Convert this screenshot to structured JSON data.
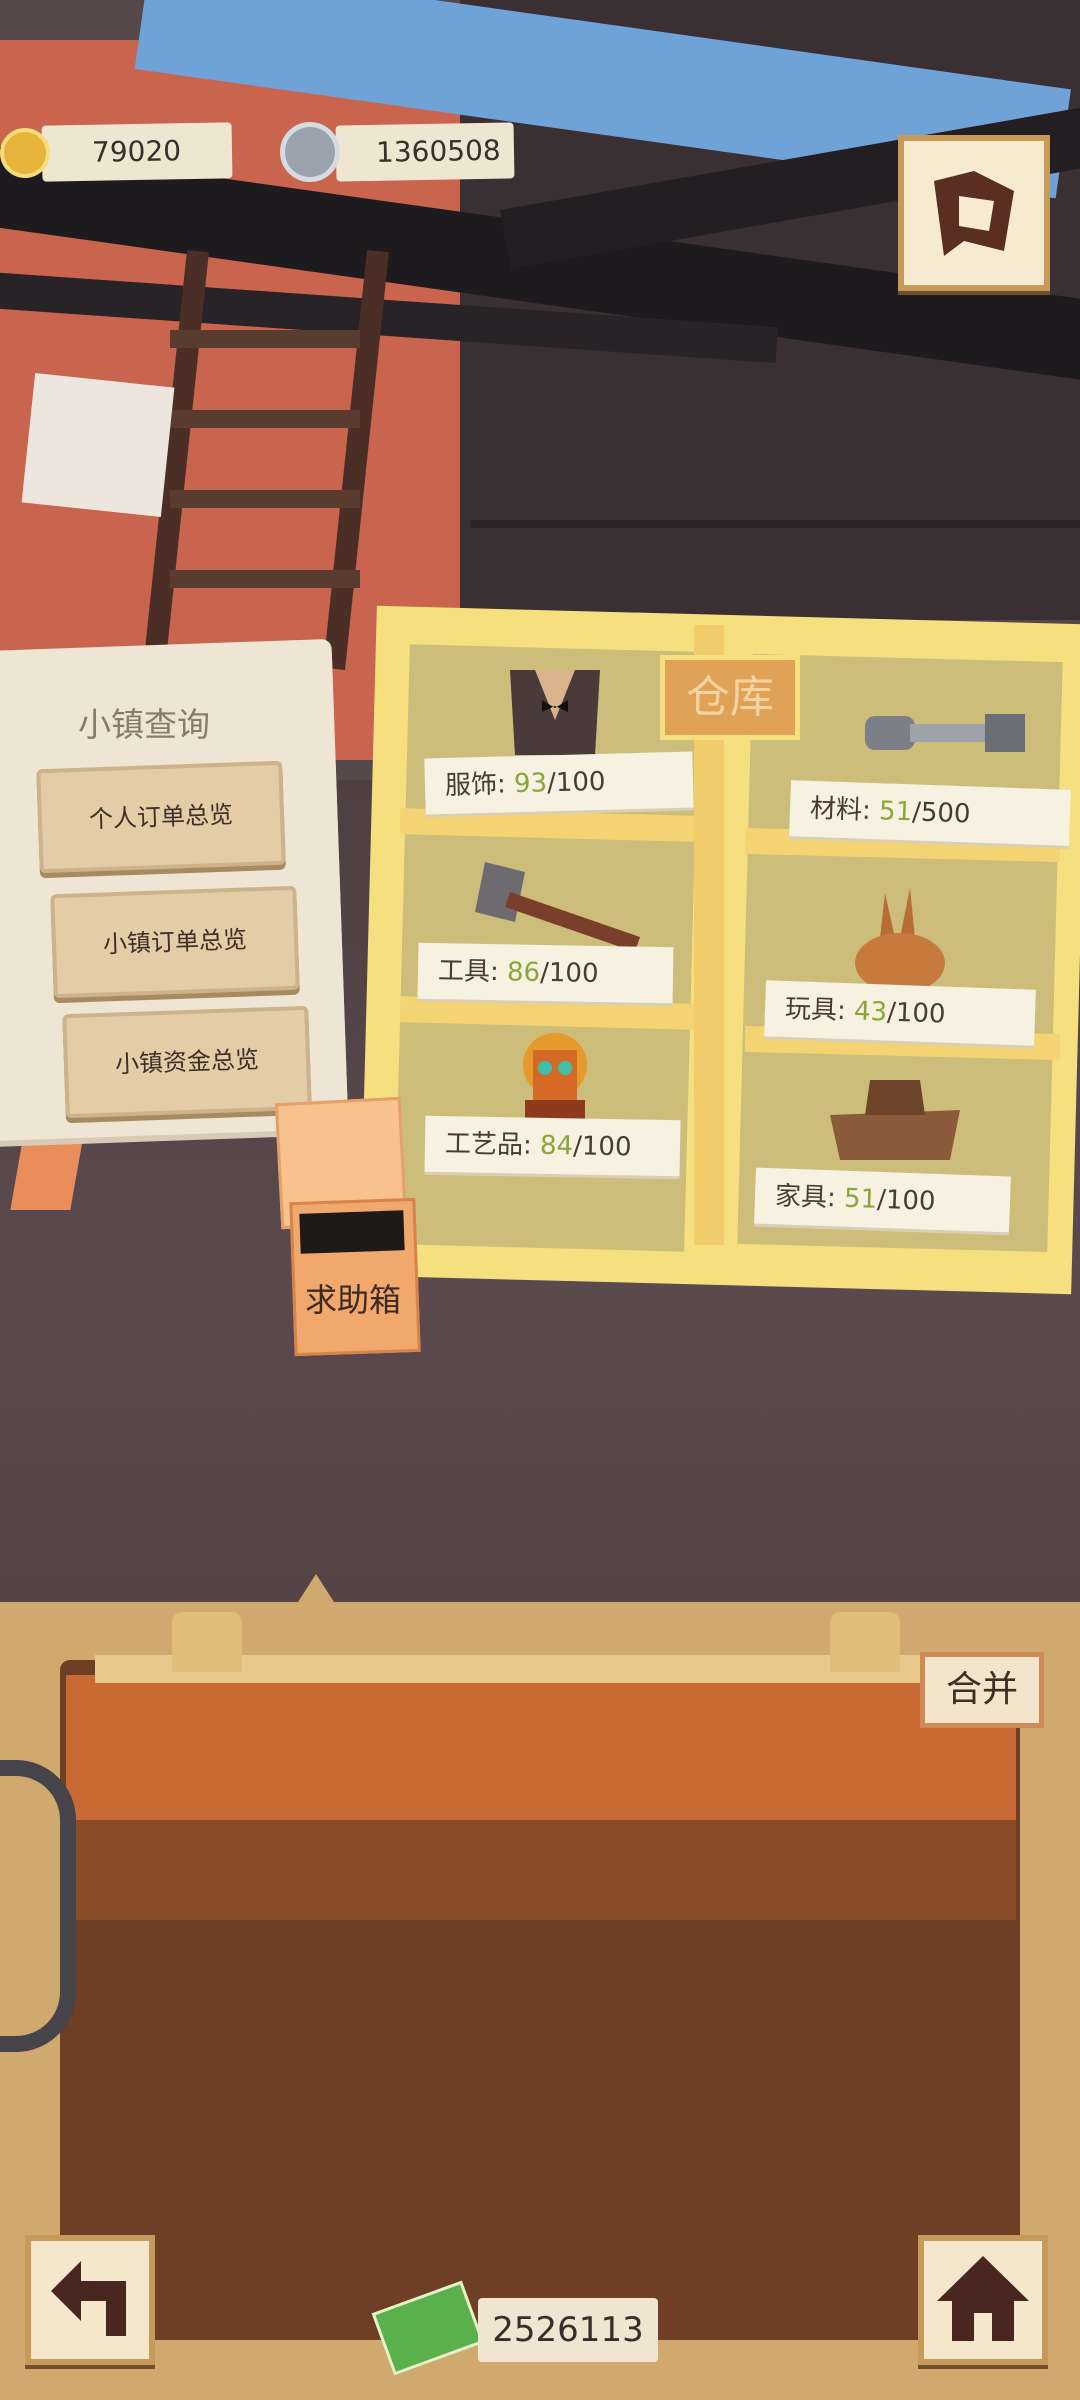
{
  "hud": {
    "gold_amount": "79020",
    "silver_amount": "1360508",
    "gold_icon": "gold-coin-icon",
    "silver_icon": "silver-gear-coin-icon",
    "map_icon": "map-icon"
  },
  "town_query": {
    "title": "小镇查询",
    "buttons": [
      "个人订单总览",
      "小镇订单总览",
      "小镇资金总览"
    ]
  },
  "warehouse": {
    "sign": "仓库",
    "slots": [
      {
        "label": "服饰:",
        "current": "93",
        "max": "/100",
        "icon": "tuxedo-icon"
      },
      {
        "label": "材料:",
        "current": "51",
        "max": "/500",
        "icon": "bolt-icon"
      },
      {
        "label": "工具:",
        "current": "86",
        "max": "/100",
        "icon": "axe-icon"
      },
      {
        "label": "玩具:",
        "current": "43",
        "max": "/100",
        "icon": "rabbit-toy-icon"
      },
      {
        "label": "工艺品:",
        "current": "84",
        "max": "/100",
        "icon": "totem-icon"
      },
      {
        "label": "家具:",
        "current": "51",
        "max": "/100",
        "icon": "furniture-icon"
      }
    ]
  },
  "help_box": {
    "label": "求助箱"
  },
  "bag": {
    "merge_label": "合并",
    "money": "2526113",
    "back_icon": "back-arrow-icon",
    "home_icon": "home-icon",
    "cash_icon": "cash-icon"
  },
  "colors": {
    "count_green": "#8aa63a",
    "shelf_yellow": "#f6df7f",
    "panel_tan": "#cfa96e"
  }
}
